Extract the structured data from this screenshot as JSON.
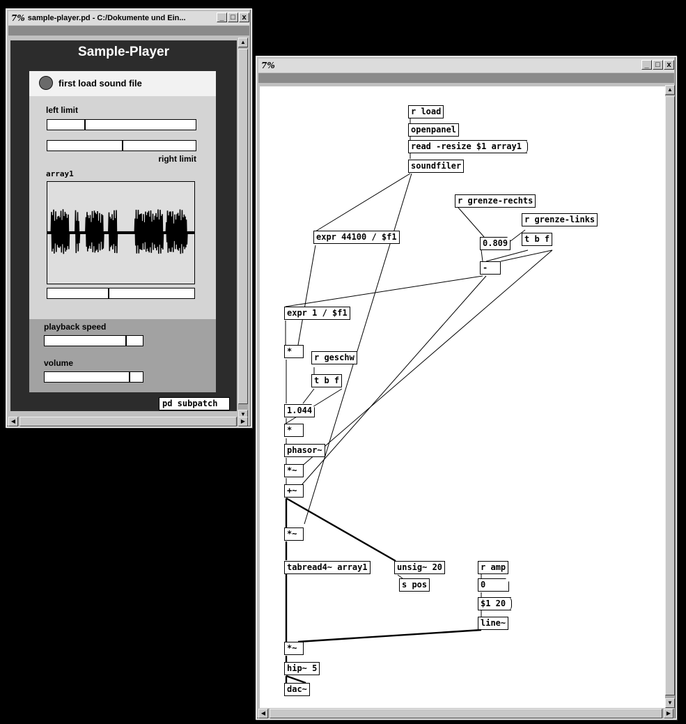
{
  "window_left": {
    "title": "sample-player.pd  - C:/Dokumente und Ein...",
    "title_icon": "7%",
    "buttons": [
      "_",
      "□",
      "x"
    ]
  },
  "window_right": {
    "title_icon": "7%",
    "buttons": [
      "_",
      "□",
      "x"
    ]
  },
  "gui": {
    "heading": "Sample-Player",
    "load_label": "first load sound file",
    "left_limit_label": "left limit",
    "right_limit_label": "right limit",
    "array_name": "array1",
    "playback_speed_label": "playback speed",
    "volume_label": "volume",
    "subpatch_label": "pd subpatch",
    "left_limit_value": 0.25,
    "right_limit_value": 0.5,
    "position_value": 0.41,
    "playback_speed_value": 0.82,
    "volume_value": 0.86
  },
  "patch": {
    "r_load": "r load",
    "openpanel": "openpanel",
    "read_msg": "read -resize $1 array1",
    "soundfiler": "soundfiler",
    "r_grenze_rechts": "r grenze-rechts",
    "r_grenze_links": "r grenze-links",
    "expr_44100": "expr 44100 / $f1",
    "num_0809": "0.809",
    "t_b_f_1": "t b f",
    "minus": "-",
    "expr_1": "expr 1 / $f1",
    "mul_1": "*",
    "r_geschw": "r geschw",
    "t_b_f_2": "t b f",
    "num_1044": "1.044",
    "mul_2": "*",
    "phasor": "phasor~",
    "mul_sig_1": "*~",
    "add_sig": "+~",
    "mul_sig_2": "*~",
    "tabread4": "tabread4~ array1",
    "unsig": "unsig~ 20",
    "s_pos": "s pos",
    "r_amp": "r amp",
    "num_0": "0",
    "msg_line": "$1 20",
    "line_sig": "line~",
    "mul_sig_3": "*~",
    "hip": "hip~ 5",
    "dac": "dac~"
  }
}
